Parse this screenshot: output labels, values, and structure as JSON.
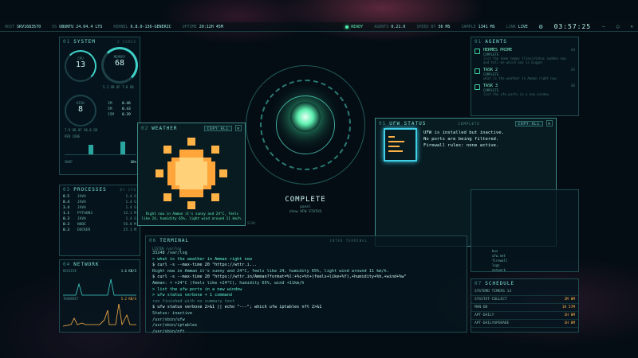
{
  "topbar": {
    "host_k": "HOST",
    "host_v": "SRV1683570",
    "os_k": "OS",
    "os_v": "UBUNTU 24.04.4 LTS",
    "kernel_k": "KERNEL",
    "kernel_v": "6.8.0-136-GENERIC",
    "uptime_k": "UPTIME",
    "uptime_v": "20:12H 45M",
    "status": "READY",
    "agents_k": "AGENTS",
    "agents_v": "0.21.0",
    "speed_k": "SPEED BY",
    "speed_v": "56 MS",
    "sample_k": "SAMPLE",
    "sample_v": "1341 MS",
    "link_k": "LINK",
    "link_v": "LIVE",
    "clock": "03:57:25"
  },
  "system": {
    "num": "01",
    "title": "SYSTEM",
    "cores": "2 CORES",
    "cpu_label": "CPU",
    "cpu_val": "13",
    "mem_label": "MEMORY",
    "mem_val": "68",
    "mem_sub": "5.2 GB OF 7.8 GB",
    "disk_label": "DISK",
    "disk_val": "8",
    "load": [
      {
        "k": "1M",
        "v": "0.46"
      },
      {
        "k": "5M",
        "v": "0.43"
      },
      {
        "k": "15M",
        "v": "0.39"
      }
    ],
    "disk_sub": "7.9 GB OF 96.8 GB",
    "per_core": "PER CORE",
    "swap_k": "SWAP",
    "swap_v": "68%"
  },
  "weather": {
    "num": "02",
    "title": "WEATHER",
    "copy": "COPY ALL",
    "text": "Right now in Amman it's sunny and 24°C, feels like 24, humidity 65%, light wind around 11 km/h."
  },
  "ufw": {
    "num": "05",
    "title": "UFW STATUS",
    "state": "COMPLETE",
    "copy": "COPY ALL",
    "lines": [
      "UFW is installed but inactive.",
      "No ports are being filtered.",
      "Firewall rules: none active."
    ]
  },
  "orb": {
    "status": "COMPLETE",
    "sub1": "panel",
    "sub2": "show UFW STATUS",
    "scan": "SCAN"
  },
  "processes": {
    "num": "03",
    "title": "PROCESSES",
    "sort": "BY CPU",
    "rows": [
      {
        "pct": "8.5",
        "name": "JAVA",
        "mem": "1.4 G"
      },
      {
        "pct": "8.4",
        "name": "JAVA",
        "mem": "1.4 G"
      },
      {
        "pct": "3.4",
        "name": "JAVA",
        "mem": "1.4 G"
      },
      {
        "pct": "1.1",
        "name": "PYTHON3",
        "mem": "12.1 M"
      },
      {
        "pct": "0.3",
        "name": "JAVA",
        "mem": "1.4 G"
      },
      {
        "pct": "0.3",
        "name": "NODE",
        "mem": "56.0 M"
      },
      {
        "pct": "0.3",
        "name": "DOCKER",
        "mem": "25.1 M"
      }
    ]
  },
  "network": {
    "num": "04",
    "title": "NETWORK",
    "rx_k": "RECEIVE",
    "rx_v": "1.6 KB/S",
    "tx_k": "TRANSMIT",
    "tx_v": "5.2 KB/S"
  },
  "terminal": {
    "num": "06",
    "title": "TERMINAL",
    "mode": "INTER TERMINAL",
    "lines": [
      {
        "c": "",
        "t": "LISTEN /var/log"
      },
      {
        "c": "",
        "t": "33248 /var/log"
      },
      {
        "c": "p",
        "t": "> what is the weather in Amman right now"
      },
      {
        "c": "bold",
        "t": "$ curl -s --max-time 20 \"https://wttr.i..."
      },
      {
        "c": "",
        "t": "  Right now in Amman it's sunny and 24°C, feels like 24, humidity 65%, light wind around 11 km/h."
      },
      {
        "c": "bold",
        "t": "$ curl -s --max-time 20 \"https://wttr.in/Amman?format=%l:+%c+%t+(feels+like+%f),+humidity+%h,+wind+%w\""
      },
      {
        "c": "",
        "t": "  Amman:  ☀  +24°C (feels like +24°C), humidity 65%, wind +11km/h"
      },
      {
        "c": "p",
        "t": "> list the ufw ports in a new window"
      },
      {
        "c": "p",
        "t": "> ufw status verbose + 1 command"
      },
      {
        "c": "",
        "t": "  run finished with no summary text"
      },
      {
        "c": "bold",
        "t": "$ ufw status verbose 2>&1 || echo \"---\"; which ufw iptables nft 2>&1"
      },
      {
        "c": "",
        "t": "  Status: inactive"
      },
      {
        "c": "",
        "t": "  /usr/sbin/ufw"
      },
      {
        "c": "",
        "t": "  /usr/sbin/iptables"
      },
      {
        "c": "",
        "t": "  /usr/sbin/nft"
      }
    ]
  },
  "agents": {
    "num": "01",
    "title": "AGENTS",
    "items": [
      {
        "t": "HERMES PRIME",
        "s": "COMPLETE",
        "d": "list the home temps files/status sudden now and tell me which one is bigger",
        "n": "04"
      },
      {
        "t": "TASK 2",
        "s": "COMPLETE",
        "d": "what is the weather in Amman right now",
        "n": "05"
      },
      {
        "t": "TASK 3",
        "s": "COMPLETE",
        "d": "list the ufw ports in a new window",
        "n": "06"
      }
    ]
  },
  "tree": {
    "items": [
      "bus",
      "ufw.net",
      "firewall",
      "logs",
      "network"
    ]
  },
  "schedule": {
    "num": "07",
    "title": "SCHEDULE",
    "rows": [
      {
        "k": "SYSTEMD TIMERS 13",
        "v": ""
      },
      {
        "k": "SYSSTAT-COLLECT",
        "v": "1M 0M"
      },
      {
        "k": "MAN-DB",
        "v": "1H 57M"
      },
      {
        "k": "APT-DAILY",
        "v": "1H 0M"
      },
      {
        "k": "APT-DAILYUPGRADE",
        "v": "1H 0M"
      }
    ]
  }
}
